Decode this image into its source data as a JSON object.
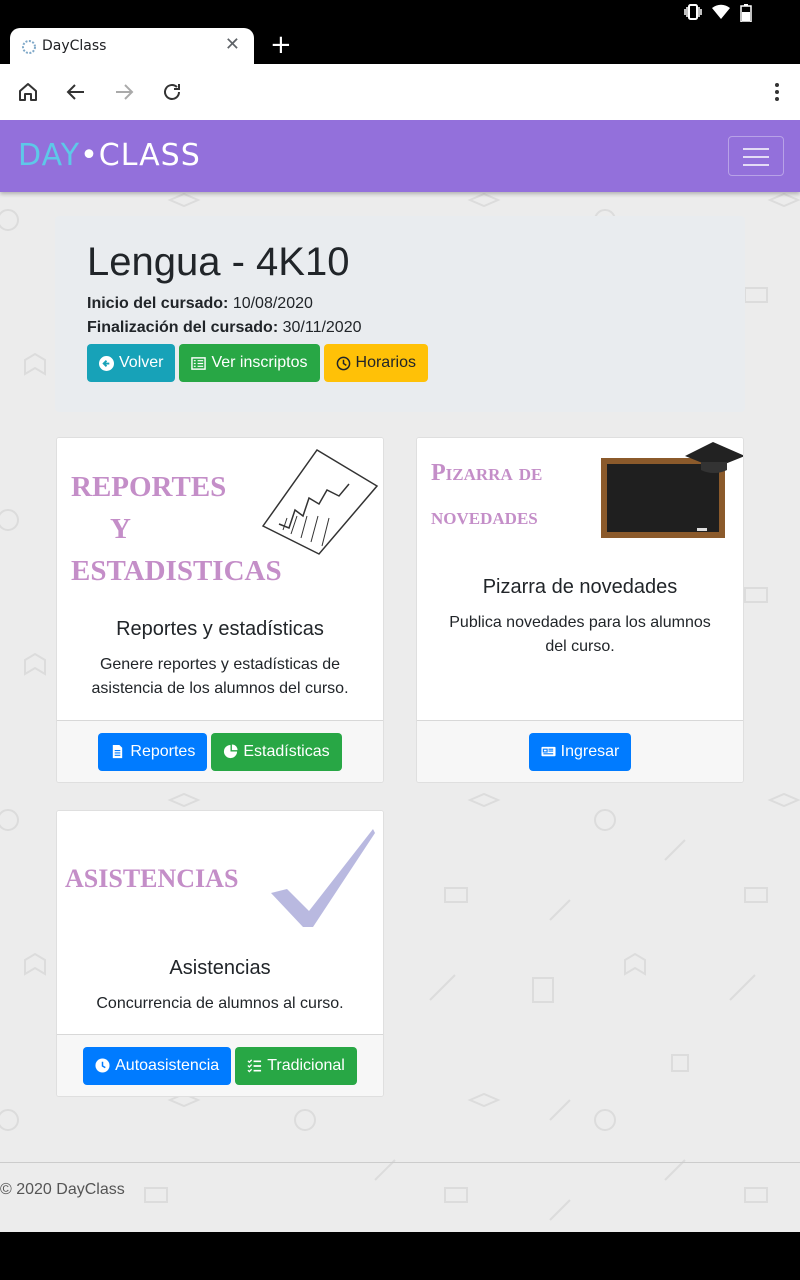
{
  "browser": {
    "tab_title": "DayClass",
    "tab_close": "✕",
    "new_tab": "+"
  },
  "navbar": {
    "brand_day": "DAY",
    "brand_dot": "•",
    "brand_class": "CLASS",
    "bg_color": "#9370db"
  },
  "course": {
    "title": "Lengua - 4K10",
    "start_label": "Inicio del cursado:",
    "start_date": "10/08/2020",
    "end_label": "Finalización del cursado:",
    "end_date": "30/11/2020",
    "buttons": {
      "back": "Volver",
      "enrolled": "Ver inscriptos",
      "schedules": "Horarios"
    }
  },
  "cards": {
    "reports": {
      "image_text_1": "REPORTES",
      "image_text_2": "Y",
      "image_text_3": "ESTADISTICAS",
      "title": "Reportes y estadísticas",
      "text": "Genere reportes y estadísticas de asistencia de los alumnos del curso.",
      "btn_reports": "Reportes",
      "btn_stats": "Estadísticas"
    },
    "board": {
      "image_text_1": "Pizarra de",
      "image_text_2": "novedades",
      "title": "Pizarra de novedades",
      "text": "Publica novedades para los alumnos del curso.",
      "btn_enter": "Ingresar"
    },
    "attendance": {
      "image_text": "ASISTENCIAS",
      "title": "Asistencias",
      "text": "Concurrencia de alumnos al curso.",
      "btn_self": "Autoasistencia",
      "btn_traditional": "Tradicional"
    }
  },
  "footer": {
    "text": "© 2020 DayClass"
  },
  "colors": {
    "info": "#17a2b8",
    "success": "#28a745",
    "warning": "#ffc107",
    "primary": "#007bff",
    "image_text": "#c48ec8"
  }
}
